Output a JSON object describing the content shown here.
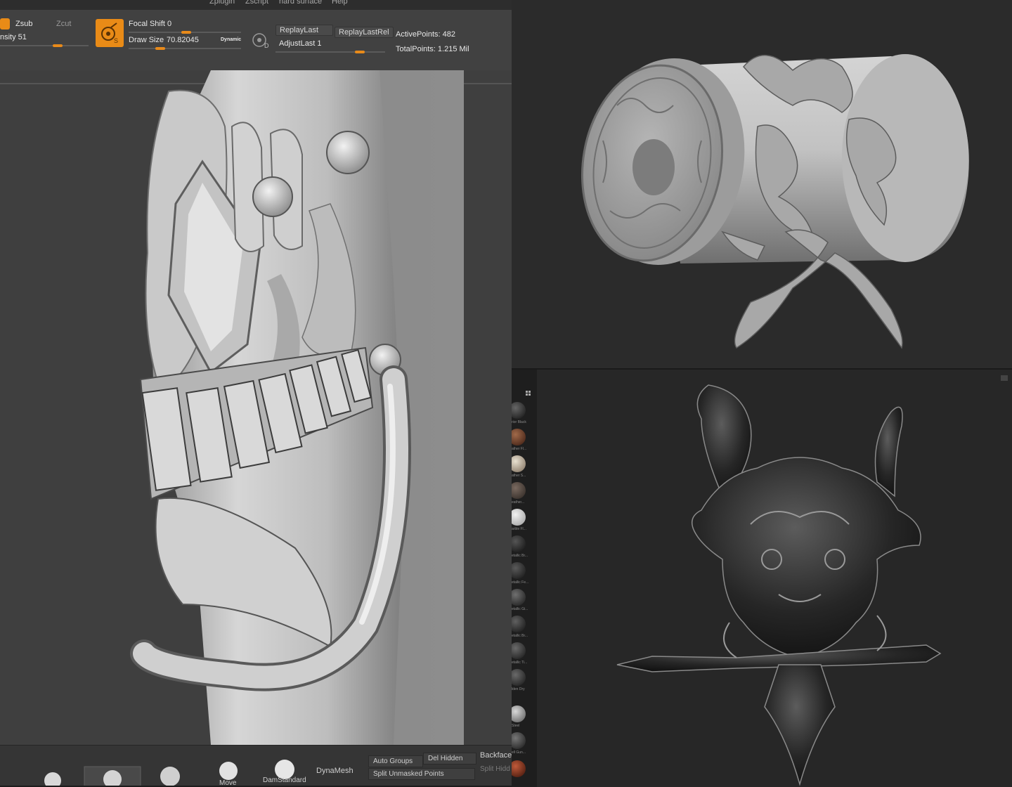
{
  "menu": {
    "items": [
      "Zplugin",
      "Zscript",
      "hard surface",
      "Help"
    ]
  },
  "toolbar": {
    "zsub_label": "Zsub",
    "zcut_label": "Zcut",
    "intensity_label": "nsity 51",
    "focal_shift_label": "Focal Shift 0",
    "draw_size_label": "Draw Size",
    "draw_size_value": "70.82045",
    "dynamic_label": "Dynamic",
    "replay_last_label": "ReplayLast",
    "replay_last_rel_label": "ReplayLastRel",
    "adjust_last_label": "AdjustLast 1",
    "active_points_label": "ActivePoints: 482",
    "total_points_label": "TotalPoints: 1.215 Mil",
    "accent_color": "#e98b17"
  },
  "bottombar": {
    "brushes": [
      "Move",
      "DamStandard"
    ],
    "dynamesh_label": "DynaMesh",
    "auto_groups_label": "Auto Groups",
    "del_hidden_label": "Del Hidden",
    "split_unmasked_label": "Split Unmasked Points",
    "backface_label": "Backfacel",
    "split_hidden_label": "Split Hidd"
  },
  "materials": {
    "labels": [
      "rior Black",
      "ather Fl...",
      "ather S...",
      "eather...",
      "arble Fl...",
      "etallic Br...",
      "etallic Fe...",
      "etallic Gi...",
      "etallic Br...",
      "etallic Ti...",
      "lden Dry",
      "Steel",
      "ell Gun..."
    ]
  }
}
